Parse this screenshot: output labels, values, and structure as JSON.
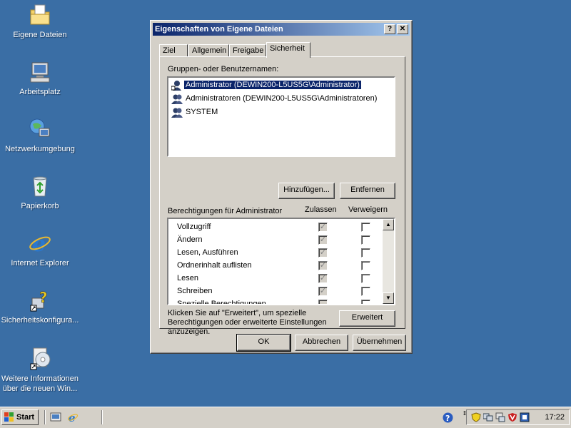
{
  "desktop": {
    "icons": [
      {
        "label": "Eigene Dateien",
        "icon": "folder-documents-icon"
      },
      {
        "label": "Arbeitsplatz",
        "icon": "computer-icon"
      },
      {
        "label": "Netzwerkumgebung",
        "icon": "network-icon"
      },
      {
        "label": "Papierkorb",
        "icon": "recycle-bin-icon"
      },
      {
        "label": "Internet Explorer",
        "icon": "internet-explorer-icon"
      },
      {
        "label": "Sicherheitskonfigura...",
        "icon": "security-config-icon"
      },
      {
        "label_line1": "Weitere Informationen",
        "label_line2": "über die neuen Win...",
        "icon": "cd-info-icon"
      }
    ]
  },
  "dialog": {
    "title": "Eigenschaften von Eigene Dateien",
    "help_btn": "?",
    "close_btn": "✕",
    "tabs": [
      {
        "label": "Ziel"
      },
      {
        "label": "Allgemein"
      },
      {
        "label": "Freigabe"
      },
      {
        "label": "Sicherheit",
        "active": true
      }
    ],
    "groups_label": "Gruppen- oder Benutzernamen:",
    "users": [
      {
        "name": "Administrator (DEWIN200-L5US5G\\Administrator)",
        "selected": true
      },
      {
        "name": "Administratoren (DEWIN200-L5US5G\\Administratoren)"
      },
      {
        "name": "SYSTEM"
      }
    ],
    "add_btn": "Hinzufügen...",
    "remove_btn": "Entfernen",
    "perms_label": "Berechtigungen für Administrator",
    "allow_header": "Zulassen",
    "deny_header": "Verweigern",
    "permissions": [
      {
        "name": "Vollzugriff",
        "allow": true,
        "deny": false
      },
      {
        "name": "Ändern",
        "allow": true,
        "deny": false
      },
      {
        "name": "Lesen, Ausführen",
        "allow": true,
        "deny": false
      },
      {
        "name": "Ordnerinhalt auflisten",
        "allow": true,
        "deny": false
      },
      {
        "name": "Lesen",
        "allow": true,
        "deny": false
      },
      {
        "name": "Schreiben",
        "allow": true,
        "deny": false
      },
      {
        "name": "Spezielle Berechtigungen",
        "allow": false,
        "deny": false
      }
    ],
    "advanced_text_1": "Klicken Sie auf \"Erweitert\", um spezielle",
    "advanced_text_2": "Berechtigungen oder erweiterte Einstellungen",
    "advanced_text_3": "anzuzeigen.",
    "advanced_btn": "Erweitert",
    "ok_btn": "OK",
    "cancel_btn": "Abbrechen",
    "apply_btn": "Übernehmen"
  },
  "taskbar": {
    "start_label": "Start",
    "clock": "17:22"
  },
  "colors": {
    "desktop": "#3a6ea5",
    "titlebar_start": "#0a246a",
    "titlebar_end": "#a6caf0",
    "face": "#d4d0c8"
  }
}
